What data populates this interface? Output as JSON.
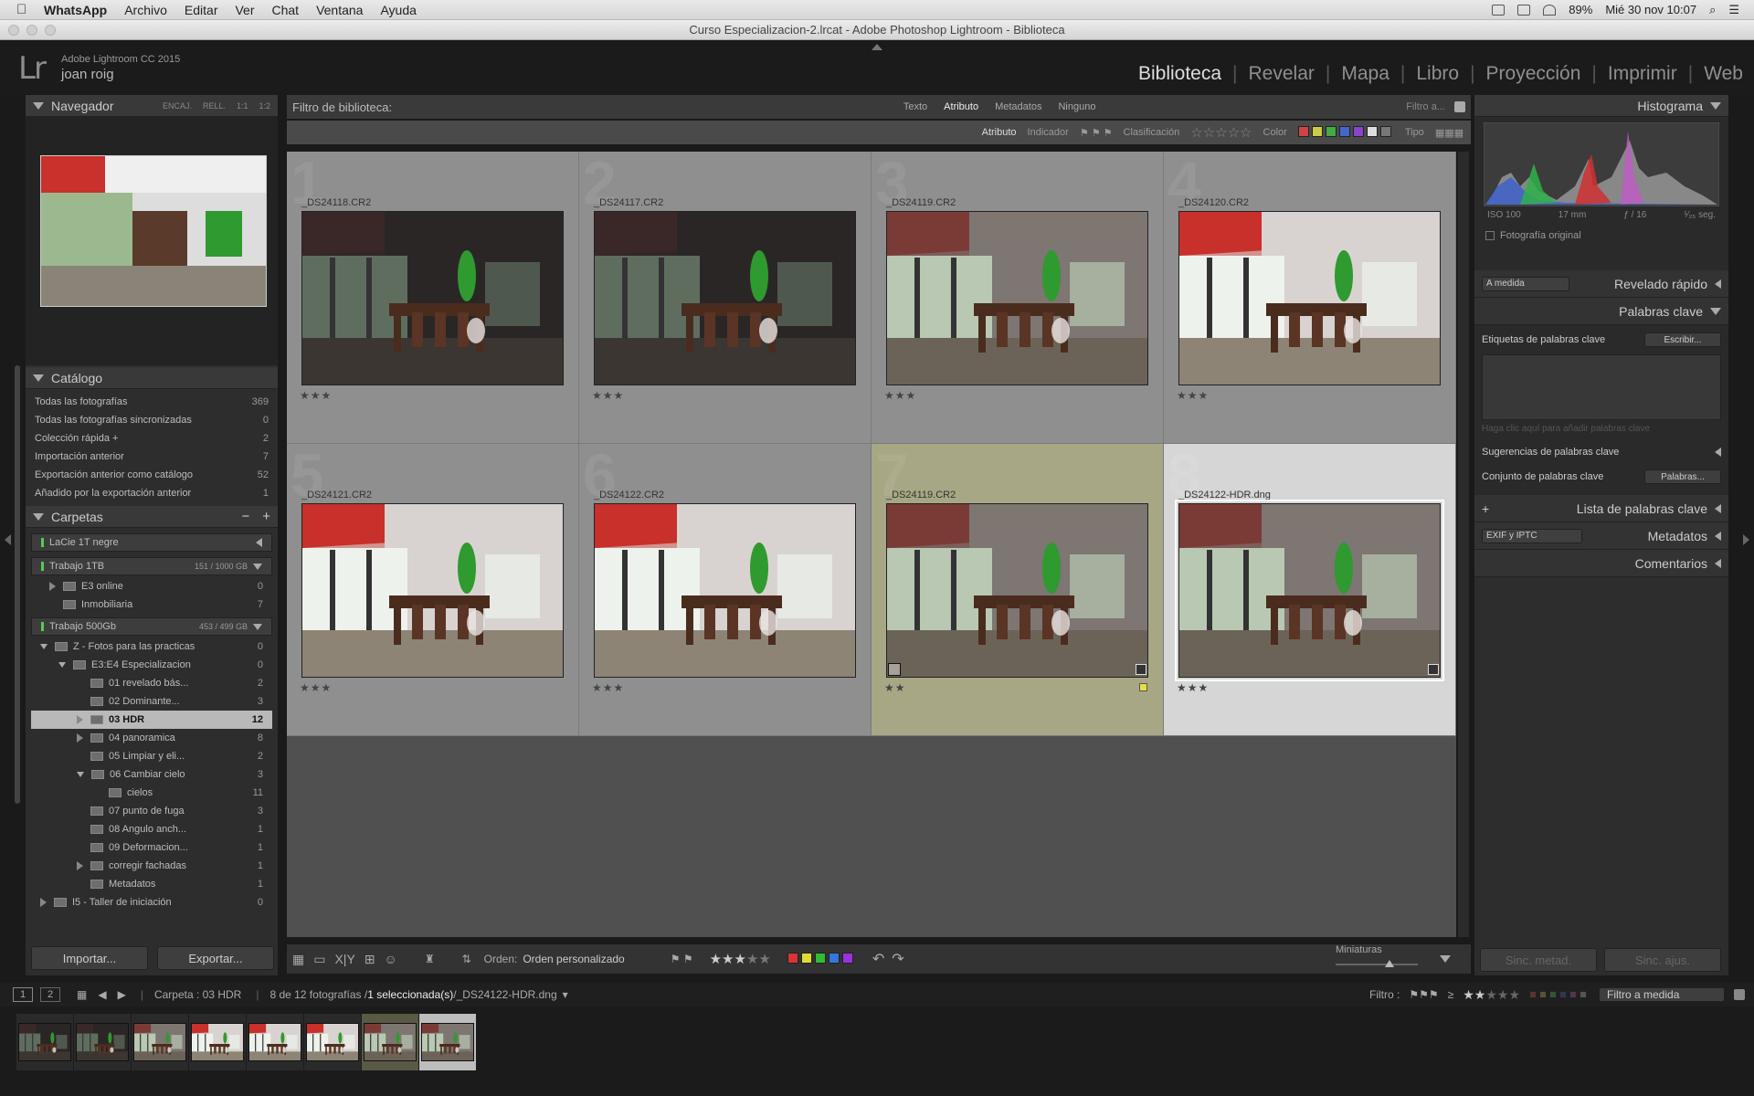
{
  "menubar": {
    "app": "WhatsApp",
    "items": [
      "Archivo",
      "Editar",
      "Ver",
      "Chat",
      "Ventana",
      "Ayuda"
    ],
    "battery": "89%",
    "datetime": "Mié 30 nov 10:07"
  },
  "window": {
    "title": "Curso Especializacion-2.lrcat - Adobe Photoshop Lightroom - Biblioteca"
  },
  "identity": {
    "logo": "Lr",
    "version": "Adobe Lightroom CC 2015",
    "user": "joan roig"
  },
  "modules": [
    {
      "label": "Biblioteca",
      "active": true
    },
    {
      "label": "Revelar"
    },
    {
      "label": "Mapa"
    },
    {
      "label": "Libro"
    },
    {
      "label": "Proyección"
    },
    {
      "label": "Imprimir"
    },
    {
      "label": "Web"
    }
  ],
  "navigator": {
    "title": "Navegador",
    "zoom": [
      "ENCAJ.",
      "RELL.",
      "1:1",
      "1:2"
    ]
  },
  "catalog": {
    "title": "Catálogo",
    "items": [
      {
        "label": "Todas las fotografías",
        "count": "369"
      },
      {
        "label": "Todas las fotografías sincronizadas",
        "count": "0"
      },
      {
        "label": "Colección rápida  +",
        "count": "2"
      },
      {
        "label": "Importación anterior",
        "count": "7"
      },
      {
        "label": "Exportación anterior como catálogo",
        "count": "52"
      },
      {
        "label": "Añadido por la exportación anterior",
        "count": "1"
      }
    ]
  },
  "folders": {
    "title": "Carpetas",
    "volumes": [
      {
        "label": "LaCie 1T negre",
        "info": ""
      },
      {
        "label": "Trabajo 1TB",
        "info": "151 / 1000 GB"
      },
      {
        "label": "Trabajo 500Gb",
        "info": "453 / 499 GB"
      }
    ],
    "vol1": [
      {
        "label": "E3 online",
        "count": "0"
      },
      {
        "label": "Inmobiliaria",
        "count": "7"
      }
    ],
    "vol2": [
      {
        "label": "Z - Fotos para las practicas",
        "count": "0",
        "indent": 1
      },
      {
        "label": "E3:E4 Especializacion",
        "count": "0",
        "indent": 2
      },
      {
        "label": "01 revelado bás...",
        "count": "2",
        "indent": 3
      },
      {
        "label": "02 Dominante...",
        "count": "3",
        "indent": 3
      },
      {
        "label": "03 HDR",
        "count": "12",
        "indent": 3,
        "selected": true
      },
      {
        "label": "04 panoramica",
        "count": "8",
        "indent": 3
      },
      {
        "label": "05 Limpiar y eli...",
        "count": "2",
        "indent": 3
      },
      {
        "label": "06 Cambiar cielo",
        "count": "3",
        "indent": 3
      },
      {
        "label": "cielos",
        "count": "11",
        "indent": 4
      },
      {
        "label": "07 punto de fuga",
        "count": "3",
        "indent": 3
      },
      {
        "label": "08 Angulo anch...",
        "count": "1",
        "indent": 3
      },
      {
        "label": "09 Deformacion...",
        "count": "1",
        "indent": 3
      },
      {
        "label": "corregir fachadas",
        "count": "1",
        "indent": 3
      },
      {
        "label": "Metadatos",
        "count": "1",
        "indent": 3
      },
      {
        "label": "I5 - Taller de iniciación",
        "count": "0",
        "indent": 1
      }
    ]
  },
  "import_label": "Importar...",
  "export_label": "Exportar...",
  "filter": {
    "title": "Filtro de biblioteca:",
    "tabs": [
      "Texto",
      "Atributo",
      "Metadatos",
      "Ninguno"
    ],
    "preset": "Filtro a...",
    "attr": "Atributo",
    "flag": "Indicador",
    "rating": "Clasificación",
    "color": "Color",
    "type": "Tipo"
  },
  "photos": [
    {
      "n": "1",
      "name": "_DS24118.CR2",
      "stars": "★★★",
      "tone": "dark"
    },
    {
      "n": "2",
      "name": "_DS24117.CR2",
      "stars": "★★★",
      "tone": "dark"
    },
    {
      "n": "3",
      "name": "_DS24119.CR2",
      "stars": "★★★",
      "tone": "mid"
    },
    {
      "n": "4",
      "name": "_DS24120.CR2",
      "stars": "★★★",
      "tone": "bright"
    },
    {
      "n": "5",
      "name": "_DS24121.CR2",
      "stars": "★★★",
      "tone": "bright"
    },
    {
      "n": "6",
      "name": "_DS24122.CR2",
      "stars": "★★★",
      "tone": "bright"
    },
    {
      "n": "7",
      "name": "_DS24119.CR2",
      "stars": "★★",
      "tone": "mid",
      "sel": true
    },
    {
      "n": "8",
      "name": "_DS24122-HDR.dng",
      "stars": "★★★",
      "tone": "mid",
      "primary": true
    }
  ],
  "toolbar": {
    "sort_label": "Orden:",
    "sort_value": "Orden personalizado",
    "thumbs": "Miniaturas",
    "stars": "★★★"
  },
  "histogram": {
    "title": "Histograma",
    "iso": "ISO 100",
    "focal": "17 mm",
    "aperture": "ƒ / 16",
    "shutter": "¹⁄₂₅ seg.",
    "original": "Fotografía original"
  },
  "right": {
    "quick": "Revelado rápido",
    "preset": "A medida",
    "keywords": "Palabras clave",
    "kwtags": "Etiquetas de palabras clave",
    "kwmode": "Escribir...",
    "kwhint": "Haga clic aquí para añadir palabras clave",
    "suggest": "Sugerencias de palabras clave",
    "kwset": "Conjunto de palabras clave",
    "kwsetval": "Palabras...",
    "kwlist": "Lista de palabras clave",
    "meta": "Metadatos",
    "metaset": "EXIF y IPTC",
    "comments": "Comentarios",
    "sync_meta": "Sinc. metad.",
    "sync_set": "Sinc. ajus."
  },
  "filmbar": {
    "pages": [
      "1",
      "2"
    ],
    "folder": "Carpeta : 03 HDR",
    "count": "8 de 12 fotografías / ",
    "selected": "1 seleccionada(s)",
    "file": " /_DS24122-HDR.dng",
    "filter": "Filtro :",
    "ge": "≥",
    "preset": "Filtro a medida"
  }
}
